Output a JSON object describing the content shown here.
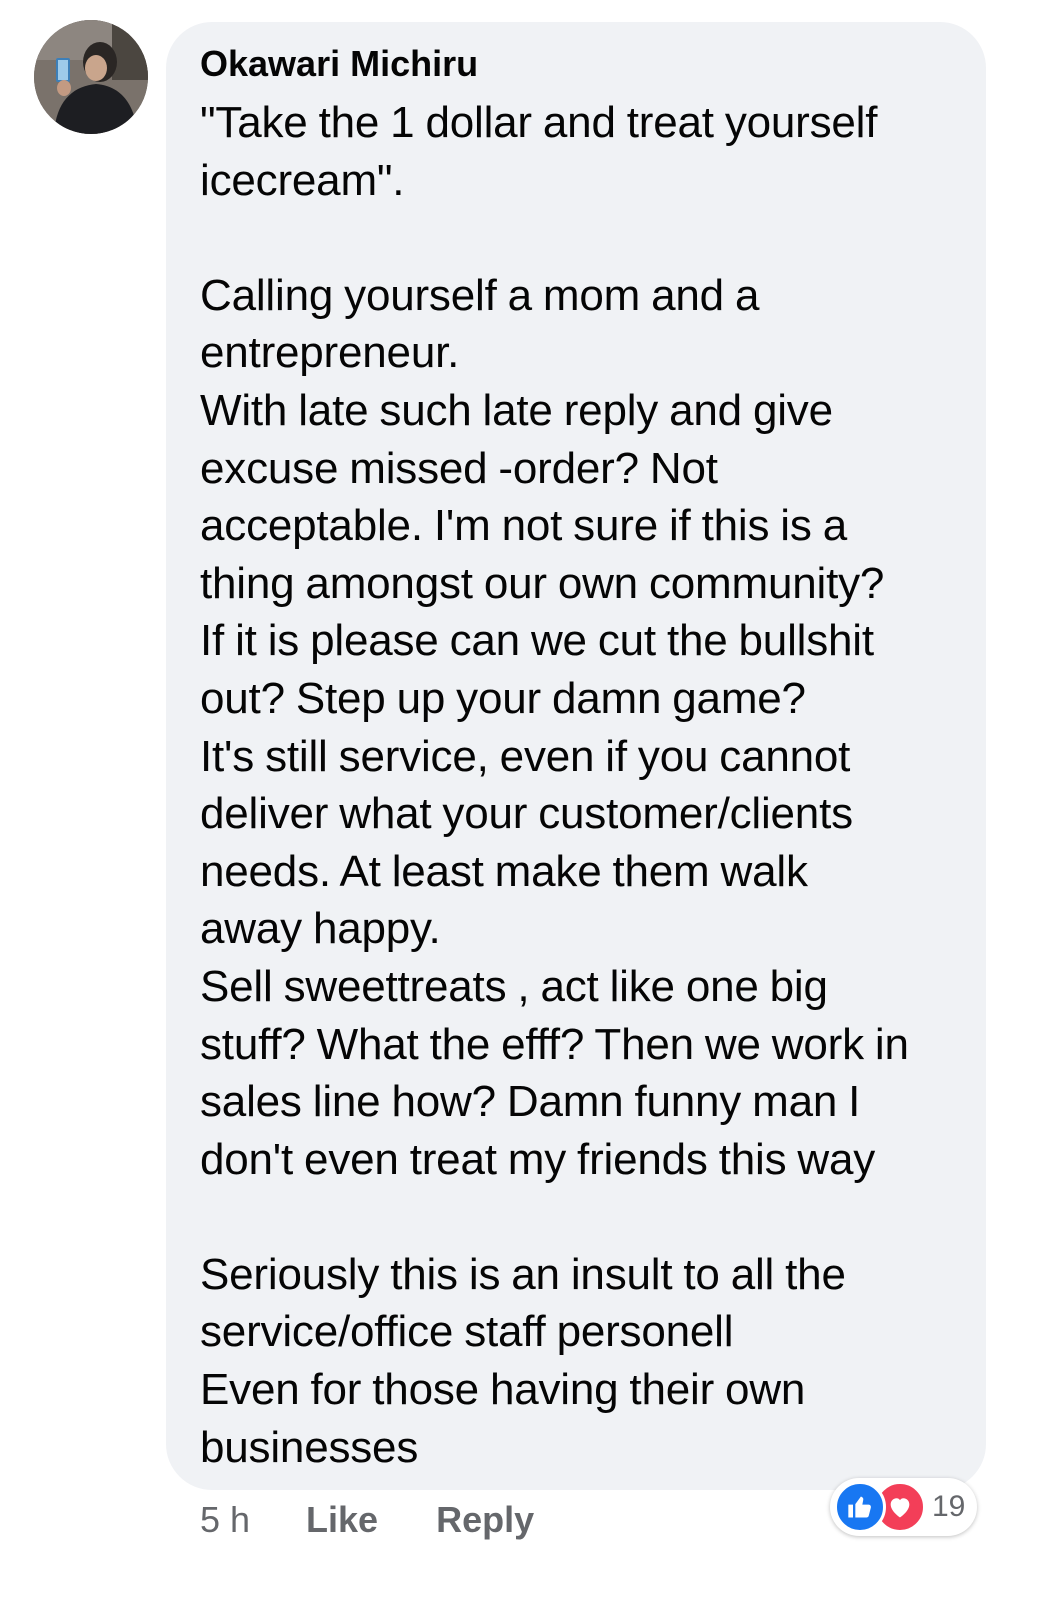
{
  "comment": {
    "author": "Okawari Michiru",
    "text": "\"Take the 1 dollar and treat yourself\nicecream\".\n\nCalling yourself a mom and a\nentrepreneur.\nWith late such late reply and give\nexcuse missed -order? Not\nacceptable. I'm not sure if this is a\nthing amongst our own community?\nIf it is please can we cut the bullshit\nout? Step up your damn game?\nIt's still service, even if you cannot\ndeliver what your customer/clients\nneeds. At least make them walk\naway happy.\nSell sweettreats , act like one big\nstuff? What the efff? Then we work in\nsales line how? Damn funny man I\ndon't even treat my friends this way\n\nSeriously this is an insult to all the\nservice/office staff personell\nEven for those having their own\nbusinesses",
    "time": "5 h",
    "like_label": "Like",
    "reply_label": "Reply",
    "reactions": {
      "icons": [
        "like-icon",
        "love-icon"
      ],
      "count": "19"
    }
  },
  "colors": {
    "bubble": "#f0f2f5",
    "meta_text": "#65676b",
    "like_blue": "#1877f2",
    "love_red": "#f33e58"
  }
}
